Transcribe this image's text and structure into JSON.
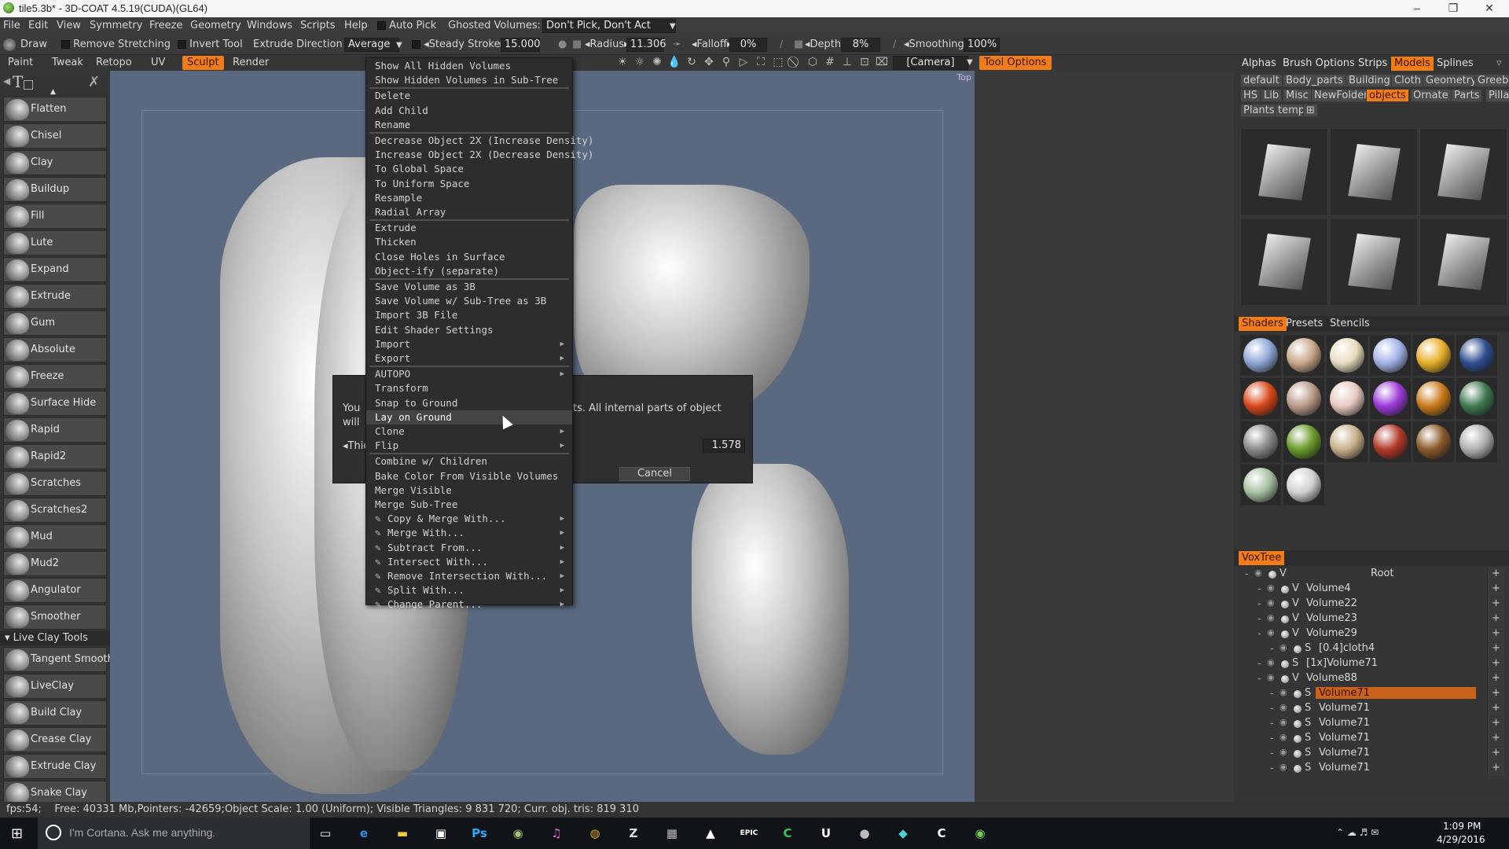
{
  "window": {
    "title": "tile5.3b* - 3D-COAT 4.5.19(CUDA)(GL64)",
    "controls": [
      "minimize",
      "maximize",
      "close"
    ]
  },
  "menubar": {
    "items": [
      "File",
      "Edit",
      "View",
      "Symmetry",
      "Freeze",
      "Geometry",
      "Windows",
      "Scripts",
      "Help"
    ],
    "auto_pick_label": "Auto Pick",
    "ghosted_label": "Ghosted Volumes:",
    "ghosted_value": "Don't Pick, Don't Act"
  },
  "toolbar": {
    "tool_name": "Draw",
    "remove_stretching": "Remove Stretching",
    "invert_tool": "Invert Tool",
    "extrude_direction_label": "Extrude Direction",
    "extrude_direction_value": "Average",
    "steady_stroke_label": "Steady Stroke",
    "steady_stroke_value": "15.000",
    "radius_label": "Radius",
    "radius_value": "11.306",
    "falloff_label": "Falloff",
    "falloff_value": "0%",
    "depth_label": "Depth",
    "depth_value": "8%",
    "smoothing_label": "Smoothing",
    "smoothing_value": "100%"
  },
  "room_tabs": {
    "items": [
      "Paint",
      "Tweak",
      "Retopo",
      "UV",
      "Sculpt",
      "Render"
    ],
    "active": "Sculpt"
  },
  "viewport": {
    "camera_select": "[Camera]",
    "tool_options_tab": "Tool Options",
    "view_label": "Top",
    "nav_icons": [
      "light-icon",
      "light-local-icon",
      "light-move-icon",
      "drop-icon",
      "rotate-icon",
      "pan-icon",
      "zoom-icon",
      "perspective-icon",
      "frame-all-icon",
      "frame-pen-icon",
      "no-icon",
      "cube-icon",
      "grid-icon",
      "axes-icon",
      "fit-icon",
      "ortho-icon"
    ]
  },
  "left_tools": {
    "items": [
      "Flatten",
      "Chisel",
      "Clay",
      "Buildup",
      "Fill",
      "Lute",
      "Expand",
      "Extrude",
      "Gum",
      "Absolute",
      "Freeze",
      "Surface Hide",
      "Rapid",
      "Rapid2",
      "Scratches",
      "Scratches2",
      "Mud",
      "Mud2",
      "Angulator",
      "Smoother"
    ],
    "section_label": "Live Clay  Tools",
    "live_items": [
      "Tangent Smooth",
      "LiveClay",
      "Build Clay",
      "Crease Clay",
      "Extrude Clay",
      "Snake Clay"
    ]
  },
  "context_menu": {
    "groups": [
      [
        {
          "label": "Show  All  Hidden  Volumes"
        },
        {
          "label": "Show  Hidden  Volumes  in  Sub-Tree"
        }
      ],
      [
        {
          "label": "Delete"
        },
        {
          "label": "Add  Child"
        },
        {
          "label": "Rename"
        }
      ],
      [
        {
          "label": "Decrease  Object  2X  (Increase  Density)"
        },
        {
          "label": "Increase  Object  2X  (Decrease  Density)"
        },
        {
          "label": "To  Global  Space"
        },
        {
          "label": "To  Uniform  Space"
        },
        {
          "label": "Resample"
        },
        {
          "label": "Radial  Array"
        }
      ],
      [
        {
          "label": "Extrude"
        },
        {
          "label": "Thicken"
        },
        {
          "label": "Close  Holes  in  Surface"
        },
        {
          "label": "Object-ify  (separate)"
        }
      ],
      [
        {
          "label": "Save  Volume  as  3B"
        },
        {
          "label": "Save  Volume  w/  Sub-Tree  as  3B"
        },
        {
          "label": "Import  3B  File"
        },
        {
          "label": "Edit  Shader  Settings"
        },
        {
          "label": "Import",
          "sub": true
        },
        {
          "label": "Export",
          "sub": true
        }
      ],
      [
        {
          "label": "AUTOPO",
          "sub": true
        },
        {
          "label": "Transform"
        },
        {
          "label": "Snap  to  Ground"
        },
        {
          "label": "Lay  on  Ground",
          "hl": true
        },
        {
          "label": "Clone",
          "sub": true
        },
        {
          "label": "Flip",
          "sub": true
        }
      ],
      [
        {
          "label": "Combine  w/  Children"
        },
        {
          "label": "Bake  Color  From  Visible  Volumes"
        },
        {
          "label": "Merge  Visible"
        },
        {
          "label": "Merge  Sub-Tree"
        },
        {
          "label": "Copy  &  Merge  With...",
          "sub": true,
          "icon": true
        },
        {
          "label": "Merge  With...",
          "sub": true,
          "icon": true
        },
        {
          "label": "Subtract  From...",
          "sub": true,
          "icon": true
        },
        {
          "label": "Intersect  With...",
          "sub": true,
          "icon": true
        },
        {
          "label": "Remove  Intersection  With...",
          "sub": true,
          "icon": true
        },
        {
          "label": "Split  With...",
          "sub": true,
          "icon": true
        },
        {
          "label": "Change  Parent...",
          "sub": true,
          "icon": true
        }
      ]
    ]
  },
  "dialog": {
    "text_line1_left": "You",
    "text_line1_right": "ts. All internal parts of object",
    "text_line2_left": "will",
    "thickness_label": "Thic",
    "thickness_value": "1.578",
    "cancel_label": "Cancel"
  },
  "right_panel": {
    "tabs": [
      "Alphas",
      "Brush Options",
      "Strips",
      "Models",
      "Splines"
    ],
    "active_tab": "Models",
    "folders": [
      "default",
      "Body_parts",
      "Building",
      "Cloth",
      "Geometry",
      "Greebles",
      "HS",
      "Lib",
      "Misc",
      "NewFolder",
      "objects",
      "Ornate",
      "Parts",
      "Pillar",
      "Plants",
      "temp"
    ],
    "active_folder": "objects",
    "models_count": 6,
    "shader_tabs": [
      "Shaders",
      "Presets",
      "Stencils"
    ],
    "active_shader_tab": "Shaders",
    "shader_colors": [
      "#8fa6d6",
      "#c9a88a",
      "#e8dcc0",
      "#a3b3e8",
      "#e8b02a",
      "#2f4f8f",
      "#d8481a",
      "#b89a86",
      "#e6c9c0",
      "#9b3ad8",
      "#c87a1a",
      "#3f7a52",
      "#8a8a8a",
      "#6a9a2a",
      "#c8b08a",
      "#b23a2a",
      "#8a5a2a",
      "#b0b0b0",
      "#a6c0a0",
      "#d0d0d0"
    ],
    "voxtree_label": "VoxTree",
    "voxtree": [
      {
        "indent": 0,
        "kind": "V",
        "name": "Root",
        "center": true
      },
      {
        "indent": 1,
        "kind": "V",
        "name": "Volume4"
      },
      {
        "indent": 1,
        "kind": "V",
        "name": "Volume22"
      },
      {
        "indent": 1,
        "kind": "V",
        "name": "Volume23"
      },
      {
        "indent": 1,
        "kind": "V",
        "name": "Volume29"
      },
      {
        "indent": 2,
        "kind": "S",
        "name": "[0.4]cloth4"
      },
      {
        "indent": 1,
        "kind": "S",
        "name": "[1x]Volume71"
      },
      {
        "indent": 1,
        "kind": "V",
        "name": "Volume88"
      },
      {
        "indent": 2,
        "kind": "S",
        "name": "Volume71",
        "selected": true
      },
      {
        "indent": 2,
        "kind": "S",
        "name": "Volume71"
      },
      {
        "indent": 2,
        "kind": "S",
        "name": "Volume71"
      },
      {
        "indent": 2,
        "kind": "S",
        "name": "Volume71"
      },
      {
        "indent": 2,
        "kind": "S",
        "name": "Volume71"
      },
      {
        "indent": 2,
        "kind": "S",
        "name": "Volume71"
      }
    ]
  },
  "statusbar": {
    "text": "fps:54;    Free: 40331 Mb,Pointers: -42659;Object Scale: 1.00 (Uniform); Visible Triangles: 9 831 720; Curr. obj. tris: 819 310"
  },
  "taskbar": {
    "search_placeholder": "I'm Cortana. Ask me anything.",
    "apps": [
      {
        "name": "task-view",
        "glyph": "▭",
        "color": "#fff"
      },
      {
        "name": "edge",
        "glyph": "e",
        "color": "#2f8de4"
      },
      {
        "name": "file-explorer",
        "glyph": "▬",
        "color": "#f3c846"
      },
      {
        "name": "store",
        "glyph": "▣",
        "color": "#fff"
      },
      {
        "name": "photoshop",
        "glyph": "Ps",
        "color": "#31a8ff"
      },
      {
        "name": "app-3dcoat",
        "glyph": "◉",
        "color": "#a7c37a"
      },
      {
        "name": "itunes",
        "glyph": "♫",
        "color": "#e86bd8"
      },
      {
        "name": "chrome",
        "glyph": "◍",
        "color": "#e2a12a"
      },
      {
        "name": "zbrush",
        "glyph": "Z",
        "color": "#ddd"
      },
      {
        "name": "app-unknown",
        "glyph": "▦",
        "color": "#bbb"
      },
      {
        "name": "photos",
        "glyph": "▲",
        "color": "#fff"
      },
      {
        "name": "epic",
        "glyph": "EPIC",
        "color": "#fff"
      },
      {
        "name": "app-c",
        "glyph": "C",
        "color": "#35c75a"
      },
      {
        "name": "unreal",
        "glyph": "U",
        "color": "#fff"
      },
      {
        "name": "app-ball",
        "glyph": "●",
        "color": "#bbb"
      },
      {
        "name": "app-cyan",
        "glyph": "◆",
        "color": "#4fd1d9"
      },
      {
        "name": "app-c2",
        "glyph": "C",
        "color": "#fff"
      },
      {
        "name": "app-3dcoat-2",
        "glyph": "◉",
        "color": "#6fd14a"
      }
    ],
    "time": "1:09 PM",
    "date": "4/29/2016"
  },
  "colors": {
    "accent": "#f07d1a",
    "viewport_bg": "#5a6880"
  }
}
